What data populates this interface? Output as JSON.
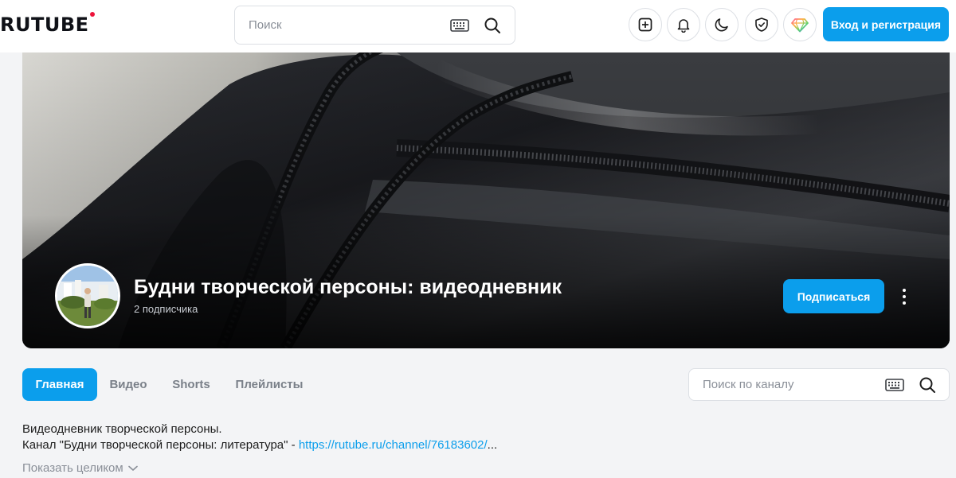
{
  "header": {
    "logo": "RUTUBE",
    "search_placeholder": "Поиск",
    "login_label": "Вход и регистрация",
    "icons": [
      "add-video-icon",
      "bell-icon",
      "moon-icon",
      "shield-icon",
      "premium-diamond-icon"
    ]
  },
  "channel": {
    "title": "Будни творческой персоны: видеодневник",
    "subscribers": "2 подписчика",
    "subscribe_label": "Подписаться"
  },
  "tabs": [
    {
      "label": "Главная",
      "active": true
    },
    {
      "label": "Видео",
      "active": false
    },
    {
      "label": "Shorts",
      "active": false
    },
    {
      "label": "Плейлисты",
      "active": false
    }
  ],
  "channel_search": {
    "placeholder": "Поиск по каналу"
  },
  "description": {
    "line1": "Видеодневник творческой персоны.",
    "line2_prefix": "Канал \"Будни творческой персоны: литература\" - ",
    "line2_link": "https://rutube.ru/channel/76183602/",
    "line2_suffix": "...",
    "show_more": "Показать целиком"
  },
  "colors": {
    "accent": "#0b9eec",
    "brand_dot": "#ed143b"
  }
}
